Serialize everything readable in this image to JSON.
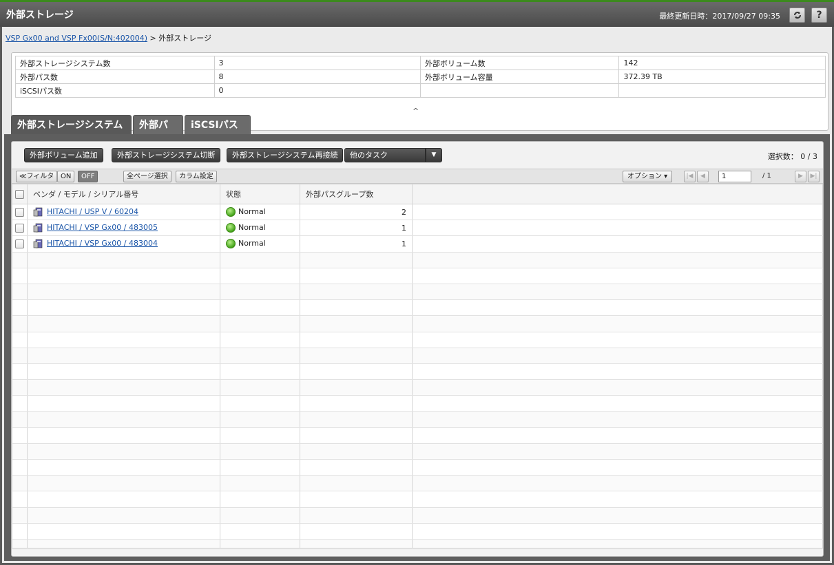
{
  "header": {
    "title": "外部ストレージ",
    "updated": "最終更新日時：2017/09/27 09:35",
    "help_label": "?"
  },
  "breadcrumb": {
    "link": "VSP Gx00 and VSP Fx00(S/N:402004)",
    "current": " > 外部ストレージ"
  },
  "summary": {
    "rows": [
      {
        "l1": "外部ストレージシステム数",
        "v1": "3",
        "l2": "外部ボリューム数",
        "v2": "142"
      },
      {
        "l1": "外部パス数",
        "v1": "8",
        "l2": "外部ボリューム容量",
        "v2": "372.39 TB"
      },
      {
        "l1": "iSCSIパス数",
        "v1": "0",
        "l2": "",
        "v2": ""
      }
    ],
    "collapse": "^"
  },
  "tabs": [
    "外部ストレージシステム",
    "外部パス",
    "iSCSIパス"
  ],
  "actions": {
    "add_volume": "外部ボリューム追加",
    "disconnect": "外部ストレージシステム切断",
    "reconnect": "外部ストレージシステム再接続",
    "more_tasks": "他のタスク",
    "selection": "選択数： 0  /  3"
  },
  "toolbar": {
    "filter": "≪フィルタ",
    "on": "ON",
    "off": "OFF",
    "select_all": "全ページ選択",
    "columns": "カラム設定",
    "options": "オプション ▾",
    "page": "1",
    "page_total": "/ 1"
  },
  "table": {
    "headers": [
      "ベンダ / モデル / シリアル番号",
      "状態",
      "外部パスグループ数"
    ],
    "rows": [
      {
        "name": "HITACHI / USP V / 60204",
        "status": "Normal",
        "groups": "2"
      },
      {
        "name": "HITACHI / VSP Gx00 / 483005",
        "status": "Normal",
        "groups": "1"
      },
      {
        "name": "HITACHI / VSP Gx00 / 483004",
        "status": "Normal",
        "groups": "1"
      }
    ]
  },
  "colors": {
    "accent_green": "#3c8a1e",
    "link_blue": "#1a55a8",
    "status_green": "#46a51c"
  }
}
